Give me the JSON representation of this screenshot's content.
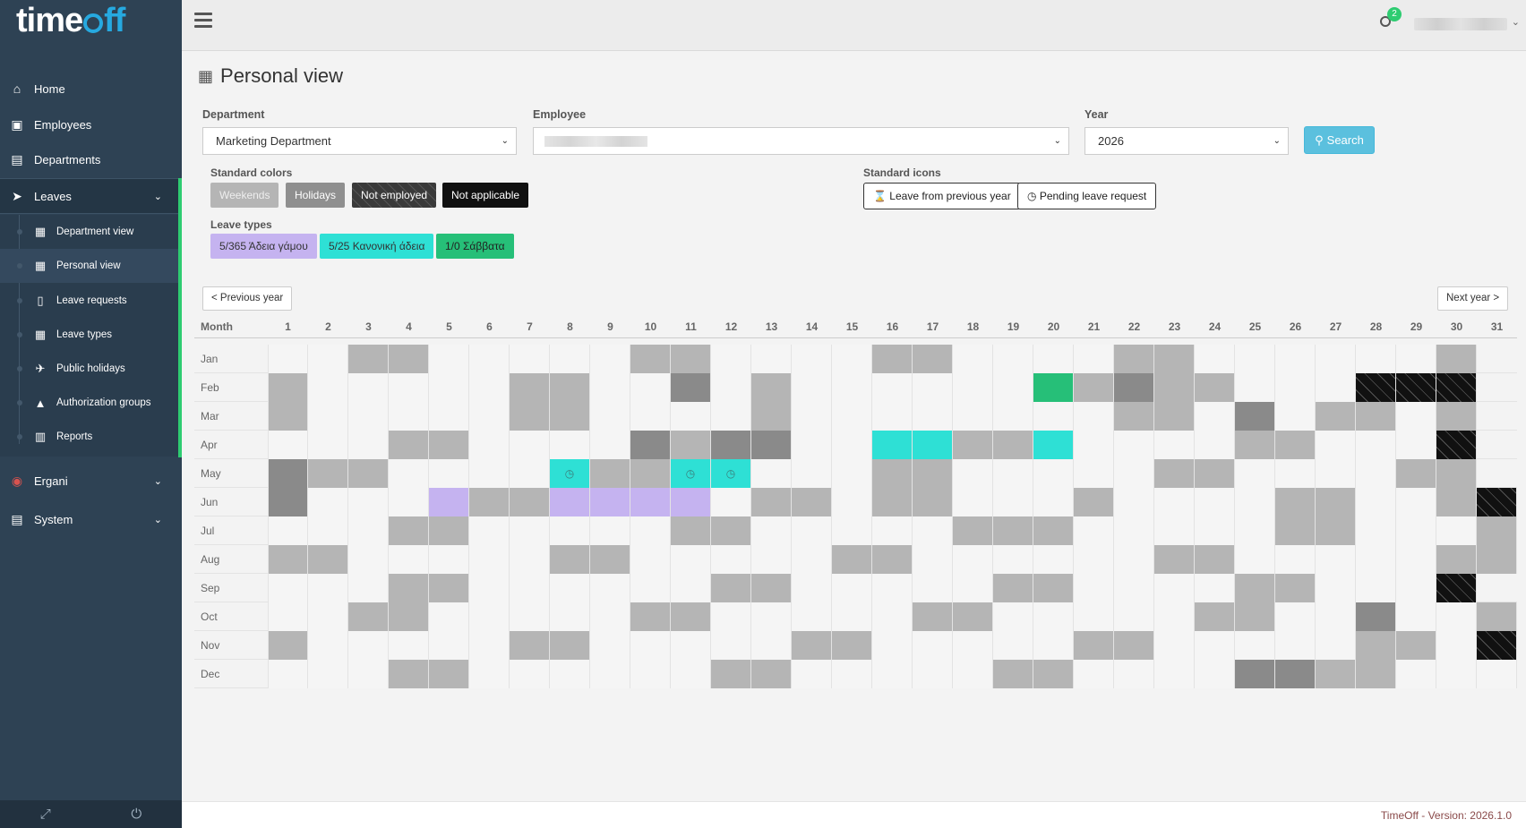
{
  "app": {
    "logo_text_1": "time",
    "logo_text_2": "ff"
  },
  "sidebar": {
    "items": [
      {
        "label": "Home",
        "icon": "home-icon"
      },
      {
        "label": "Employees",
        "icon": "address-book-icon"
      },
      {
        "label": "Departments",
        "icon": "building-icon"
      },
      {
        "label": "Leaves",
        "icon": "paper-plane-icon"
      },
      {
        "label": "Ergani",
        "icon": "ergani-icon"
      },
      {
        "label": "System",
        "icon": "server-icon"
      }
    ],
    "leaves_submenu": [
      {
        "label": "Department view",
        "icon": "calendar-icon"
      },
      {
        "label": "Personal view",
        "icon": "calendar-icon"
      },
      {
        "label": "Leave requests",
        "icon": "file-icon"
      },
      {
        "label": "Leave types",
        "icon": "grid-icon"
      },
      {
        "label": "Public holidays",
        "icon": "plane-icon"
      },
      {
        "label": "Authorization groups",
        "icon": "lock-icon"
      },
      {
        "label": "Reports",
        "icon": "bar-chart-icon"
      }
    ]
  },
  "topbar": {
    "notification_count": "2"
  },
  "page": {
    "title": "Personal view"
  },
  "filters": {
    "department_label": "Department",
    "department_value": "Marketing Department",
    "employee_label": "Employee",
    "year_label": "Year",
    "year_value": "2026",
    "search_label": "Search"
  },
  "legend": {
    "standard_colors_label": "Standard colors",
    "standard_colors": [
      "Weekends",
      "Holidays",
      "Not employed",
      "Not applicable"
    ],
    "standard_icons_label": "Standard icons",
    "standard_icons": [
      "Leave from previous year",
      "Pending leave request"
    ],
    "leave_types_label": "Leave types",
    "leave_types": [
      "5/365 Άδεια γάμου",
      "5/25 Κανονική άδεια",
      "1/0 Σάββατα"
    ]
  },
  "colors": {
    "weekday": "#f5f5f5",
    "weekend": "#b5b5b5",
    "holiday": "#8a8a8a",
    "not_applicable": "#111111",
    "leave_marriage": "#c5b3f0",
    "leave_annual": "#2ee0d5",
    "leave_saturday": "#26bf78",
    "accent": "#5bc0de"
  },
  "nav": {
    "prev_label": "< Previous year",
    "next_label": "Next year >"
  },
  "calendar": {
    "month_header": "Month",
    "days": [
      "1",
      "2",
      "3",
      "4",
      "5",
      "6",
      "7",
      "8",
      "9",
      "10",
      "11",
      "12",
      "13",
      "14",
      "15",
      "16",
      "17",
      "18",
      "19",
      "20",
      "21",
      "22",
      "23",
      "24",
      "25",
      "26",
      "27",
      "28",
      "29",
      "30",
      "31"
    ],
    "legend_codes": {
      "w": "weekday",
      "e": "weekend",
      "h": "holiday",
      "x": "not applicable",
      "g": "Άδεια γάμου",
      "a": "Κανονική άδεια",
      "s": "Σάββατα",
      "p": "Κανονική άδεια pending"
    },
    "months": [
      {
        "name": "Jan",
        "cells": "wweewwwwweewwwweewwwweewwwwwwe"
      },
      {
        "name": "Feb",
        "cells": "ewwwwweewwhwewwwwwwseheewwwxxx"
      },
      {
        "name": "Mar",
        "cells": "ewwwwweewwwwewwwwwwwweewhweewe"
      },
      {
        "name": "Apr",
        "cells": "wwweewwwwhehhwwaaeeawwwweewwwx"
      },
      {
        "name": "May",
        "cells": "heewwwwpeeppwwweewwwwweewwwwee"
      },
      {
        "name": "Jun",
        "cells": "hwwwgeeggggweeweewwwewwwweewwex"
      },
      {
        "name": "Jul",
        "cells": "wwweewwwwweewwwwweeewwwwweewwwe"
      },
      {
        "name": "Aug",
        "cells": "eewwwwweewwwwweewwwwwweewwwwweew"
      },
      {
        "name": "Sep",
        "cells": "wwweewwwwwweewwwwweewwwweewwwx"
      },
      {
        "name": "Oct",
        "cells": "wweewwwwweewwwwweewwwwweewwhwwe"
      },
      {
        "name": "Nov",
        "cells": "ewwwwweewwwwweewwwwweewwwwweewx"
      },
      {
        "name": "Dec",
        "cells": "wwweewwwwwweewwwwweewwwwhheewwww"
      }
    ]
  },
  "footer": {
    "version_text": "TimeOff - Version: 2026.1.0"
  }
}
